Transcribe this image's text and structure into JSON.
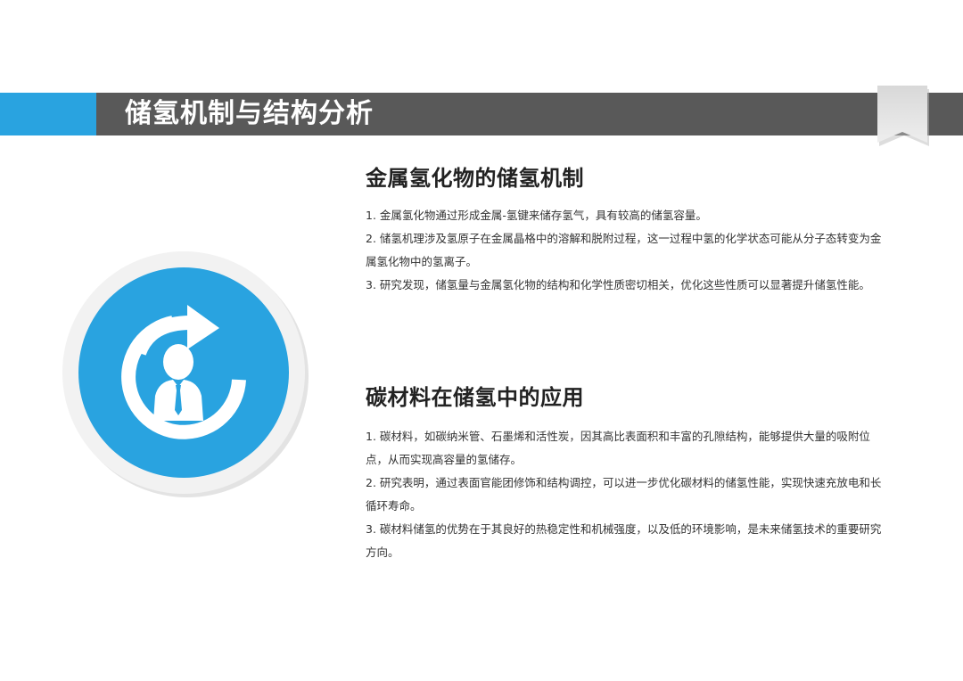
{
  "header": {
    "title": "储氢机制与结构分析"
  },
  "icon": {
    "name": "refresh-person-icon",
    "accent_color": "#29a3e0"
  },
  "sections": [
    {
      "title": "金属氢化物的储氢机制",
      "points": [
        "1. 金属氢化物通过形成金属-氢键来储存氢气，具有较高的储氢容量。",
        "2. 储氢机理涉及氢原子在金属晶格中的溶解和脱附过程，这一过程中氢的化学状态可能从分子态转变为金属氢化物中的氢离子。",
        "3. 研究发现，储氢量与金属氢化物的结构和化学性质密切相关，优化这些性质可以显著提升储氢性能。"
      ]
    },
    {
      "title": "碳材料在储氢中的应用",
      "points": [
        "1. 碳材料，如碳纳米管、石墨烯和活性炭，因其高比表面积和丰富的孔隙结构，能够提供大量的吸附位点，从而实现高容量的氢储存。",
        "2. 研究表明，通过表面官能团修饰和结构调控，可以进一步优化碳材料的储氢性能，实现快速充放电和长循环寿命。",
        "3. 碳材料储氢的优势在于其良好的热稳定性和机械强度，以及低的环境影响，是未来储氢技术的重要研究方向。"
      ]
    }
  ]
}
